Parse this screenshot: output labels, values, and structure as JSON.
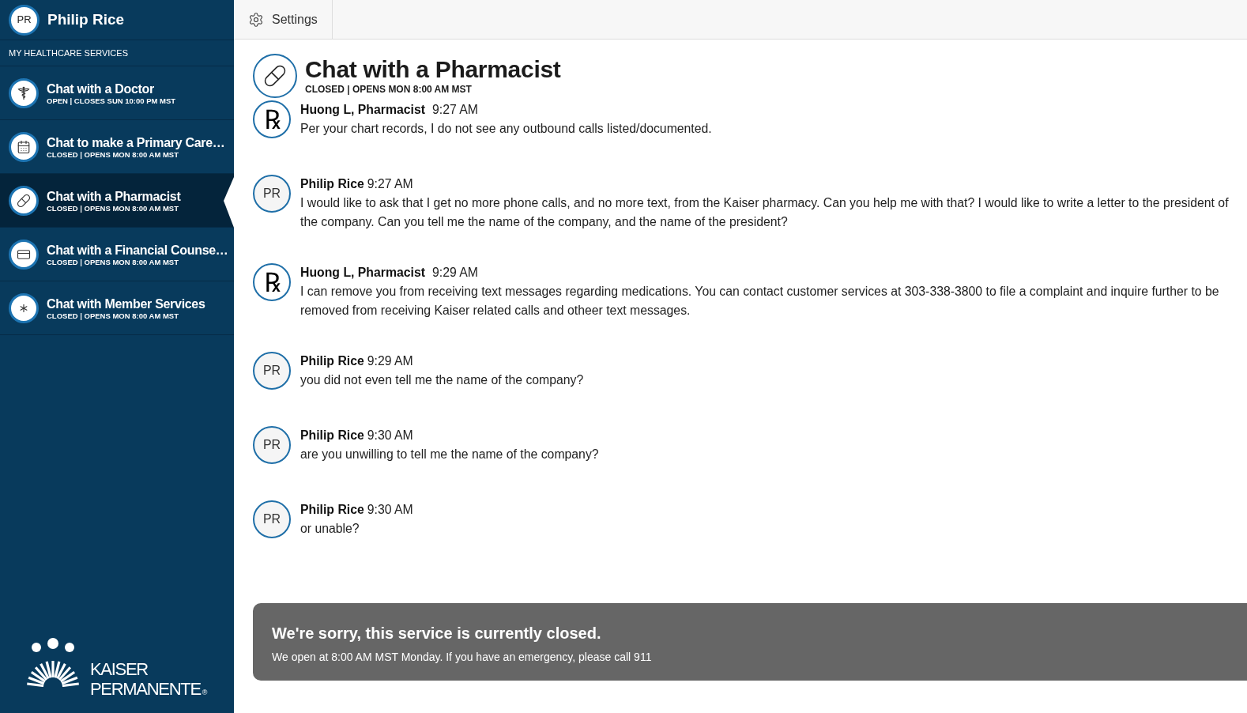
{
  "user": {
    "initials": "PR",
    "name": "Philip Rice"
  },
  "settings": {
    "label": "Settings"
  },
  "services": {
    "heading": "MY HEALTHCARE SERVICES",
    "items": [
      {
        "kind": "doctor",
        "title": "Chat with a Doctor",
        "status": "OPEN | CLOSES SUN 10:00 PM MST",
        "selected": false
      },
      {
        "kind": "appointment",
        "title": "Chat to make a Primary Care…",
        "status": "CLOSED | OPENS MON 8:00 AM MST",
        "selected": false
      },
      {
        "kind": "pharmacist",
        "title": "Chat with a Pharmacist",
        "status": "CLOSED | OPENS MON 8:00 AM MST",
        "selected": true
      },
      {
        "kind": "financial",
        "title": "Chat with a Financial Counse…",
        "status": "CLOSED | OPENS MON 8:00 AM MST",
        "selected": false
      },
      {
        "kind": "member",
        "title": "Chat with Member Services",
        "status": "CLOSED | OPENS MON 8:00 AM MST",
        "selected": false
      }
    ]
  },
  "logo": {
    "line_1": "KAISER",
    "line_2": "PERMANENTE",
    "mark": "®"
  },
  "chat": {
    "kind": "pharmacist",
    "title": "Chat with a Pharmacist",
    "status": "CLOSED | OPENS MON 8:00 AM MST"
  },
  "messages": [
    {
      "kind": "pharmacist",
      "avatar": "℞",
      "author": "Huong L, Pharmacist",
      "time": "9:27 AM",
      "text": "Per your chart records, I do not see any outbound calls listed/documented."
    },
    {
      "kind": "member",
      "avatar": "PR",
      "author": "Philip Rice",
      "time": "9:27 AM",
      "text": "I would like to ask that I get no more phone calls, and no more text, from the Kaiser pharmacy. Can you help me with that? I would like to write a letter to the president of the company. Can you tell me the name of the company, and the name of the president?"
    },
    {
      "kind": "pharmacist",
      "avatar": "℞",
      "author": "Huong L, Pharmacist",
      "time": "9:29 AM",
      "text": "I can remove you from receiving text messages regarding medications. You can contact customer services at 303-338-3800 to file a complaint and inquire further to be removed from receiving Kaiser related calls and otheer text messages."
    },
    {
      "kind": "member",
      "avatar": "PR",
      "author": "Philip Rice",
      "time": "9:29 AM",
      "text": "you did not even tell me the name of the company?"
    },
    {
      "kind": "member",
      "avatar": "PR",
      "author": "Philip Rice",
      "time": "9:30 AM",
      "text": "are you unwilling to tell me the name of the company?"
    },
    {
      "kind": "member",
      "avatar": "PR",
      "author": "Philip Rice",
      "time": "9:30 AM",
      "text": "or unable?"
    }
  ],
  "notice": {
    "title": "We're sorry, this service is currently closed.",
    "text": "We open at 8:00 AM MST Monday. If you have an emergency, please call 911"
  }
}
